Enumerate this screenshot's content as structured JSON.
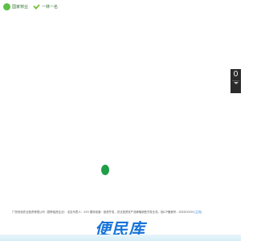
{
  "header": {
    "logos": [
      {
        "icon": "leaf-logo-icon",
        "text": "国家林业"
      },
      {
        "icon": "check-logo-icon",
        "text": "一林一名"
      }
    ]
  },
  "side_widget": {
    "number": "0"
  },
  "footer": {
    "text": "广西河池农业投资有限公司（国有独资企业） 法定代表人：XXX 服务经营：投资开发，农业投资农产品种植销售开发业务。桂ICP备案号：2023XXXXX",
    "link_text": "[主页]"
  },
  "watermark": {
    "text": "便民库"
  },
  "colors": {
    "accent_green": "#1e9e48",
    "logo_green": "#5fbf47",
    "watermark_blue": "#1673d8",
    "widget_dark": "#2b2b2b"
  }
}
